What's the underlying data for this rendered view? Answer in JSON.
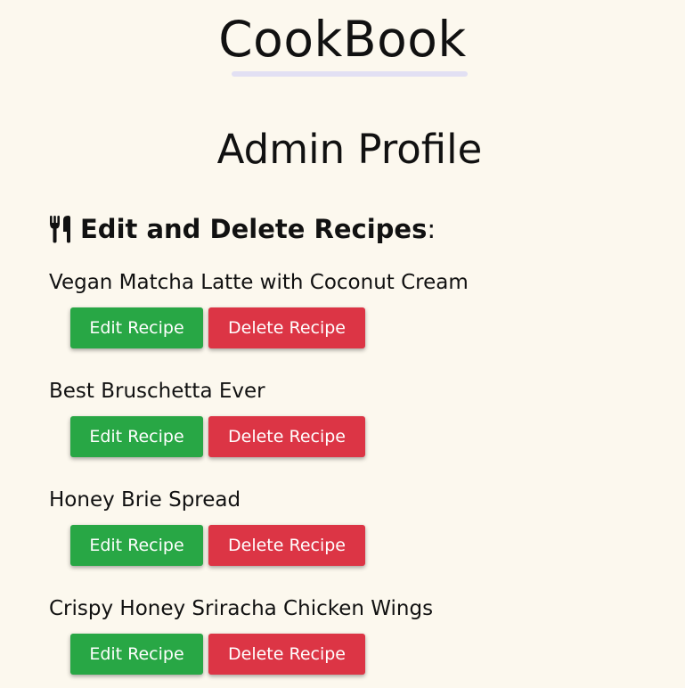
{
  "header": {
    "brand": "CookBook",
    "accent_color": "#e2e0f3"
  },
  "page_title": "Admin Profile",
  "section": {
    "icon": "utensils-icon",
    "heading_bold": "Edit and Delete Recipes",
    "heading_suffix": ":"
  },
  "recipes": [
    {
      "title": "Vegan Matcha Latte with Coconut Cream",
      "edit_label": "Edit Recipe",
      "delete_label": "Delete Recipe"
    },
    {
      "title": "Best Bruschetta Ever",
      "edit_label": "Edit Recipe",
      "delete_label": "Delete Recipe"
    },
    {
      "title": "Honey Brie Spread",
      "edit_label": "Edit Recipe",
      "delete_label": "Delete Recipe"
    },
    {
      "title": "Crispy Honey Sriracha Chicken Wings",
      "edit_label": "Edit Recipe",
      "delete_label": "Delete Recipe"
    }
  ],
  "colors": {
    "background": "#fcf8ee",
    "edit_button": "#28a745",
    "delete_button": "#dc3545"
  }
}
